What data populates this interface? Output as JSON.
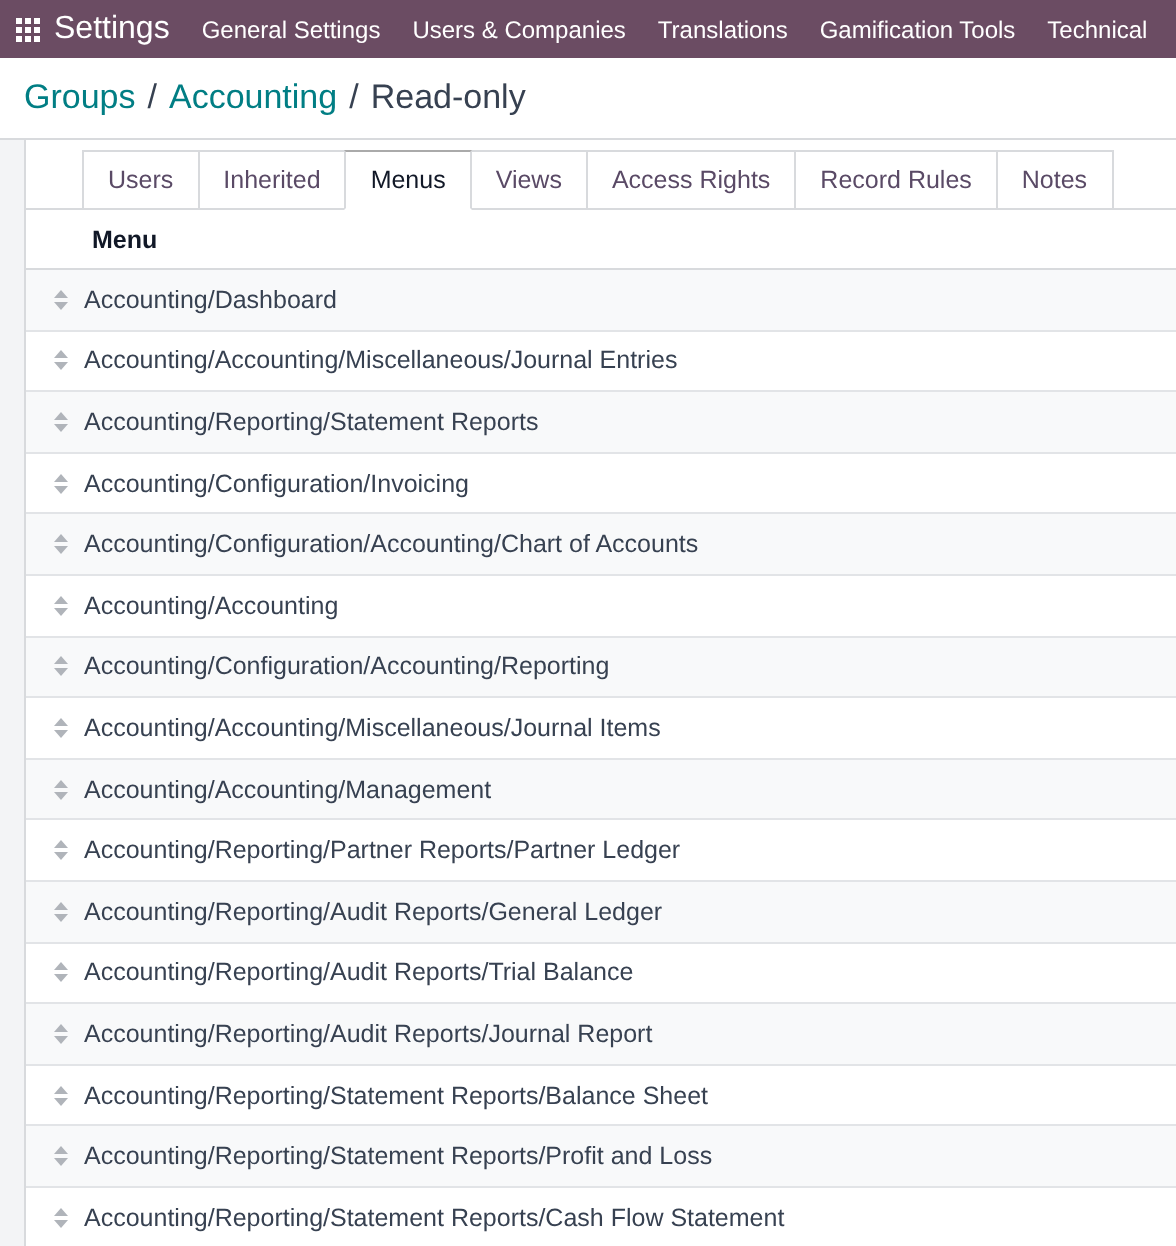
{
  "navbar": {
    "app_title": "Settings",
    "menu": [
      "General Settings",
      "Users & Companies",
      "Translations",
      "Gamification Tools",
      "Technical"
    ]
  },
  "breadcrumb": {
    "separator": "/",
    "items": [
      "Groups",
      "Accounting",
      "Read-only"
    ]
  },
  "tabs": [
    {
      "label": "Users",
      "selected": false
    },
    {
      "label": "Inherited",
      "selected": false
    },
    {
      "label": "Menus",
      "selected": true
    },
    {
      "label": "Views",
      "selected": false
    },
    {
      "label": "Access Rights",
      "selected": false
    },
    {
      "label": "Record Rules",
      "selected": false
    },
    {
      "label": "Notes",
      "selected": false
    }
  ],
  "table": {
    "columns": [
      "Menu"
    ],
    "rows": [
      "Accounting/Dashboard",
      "Accounting/Accounting/Miscellaneous/Journal Entries",
      "Accounting/Reporting/Statement Reports",
      "Accounting/Configuration/Invoicing",
      "Accounting/Configuration/Accounting/Chart of Accounts",
      "Accounting/Accounting",
      "Accounting/Configuration/Accounting/Reporting",
      "Accounting/Accounting/Miscellaneous/Journal Items",
      "Accounting/Accounting/Management",
      "Accounting/Reporting/Partner Reports/Partner Ledger",
      "Accounting/Reporting/Audit Reports/General Ledger",
      "Accounting/Reporting/Audit Reports/Trial Balance",
      "Accounting/Reporting/Audit Reports/Journal Report",
      "Accounting/Reporting/Statement Reports/Balance Sheet",
      "Accounting/Reporting/Statement Reports/Profit and Loss",
      "Accounting/Reporting/Statement Reports/Cash Flow Statement"
    ]
  }
}
